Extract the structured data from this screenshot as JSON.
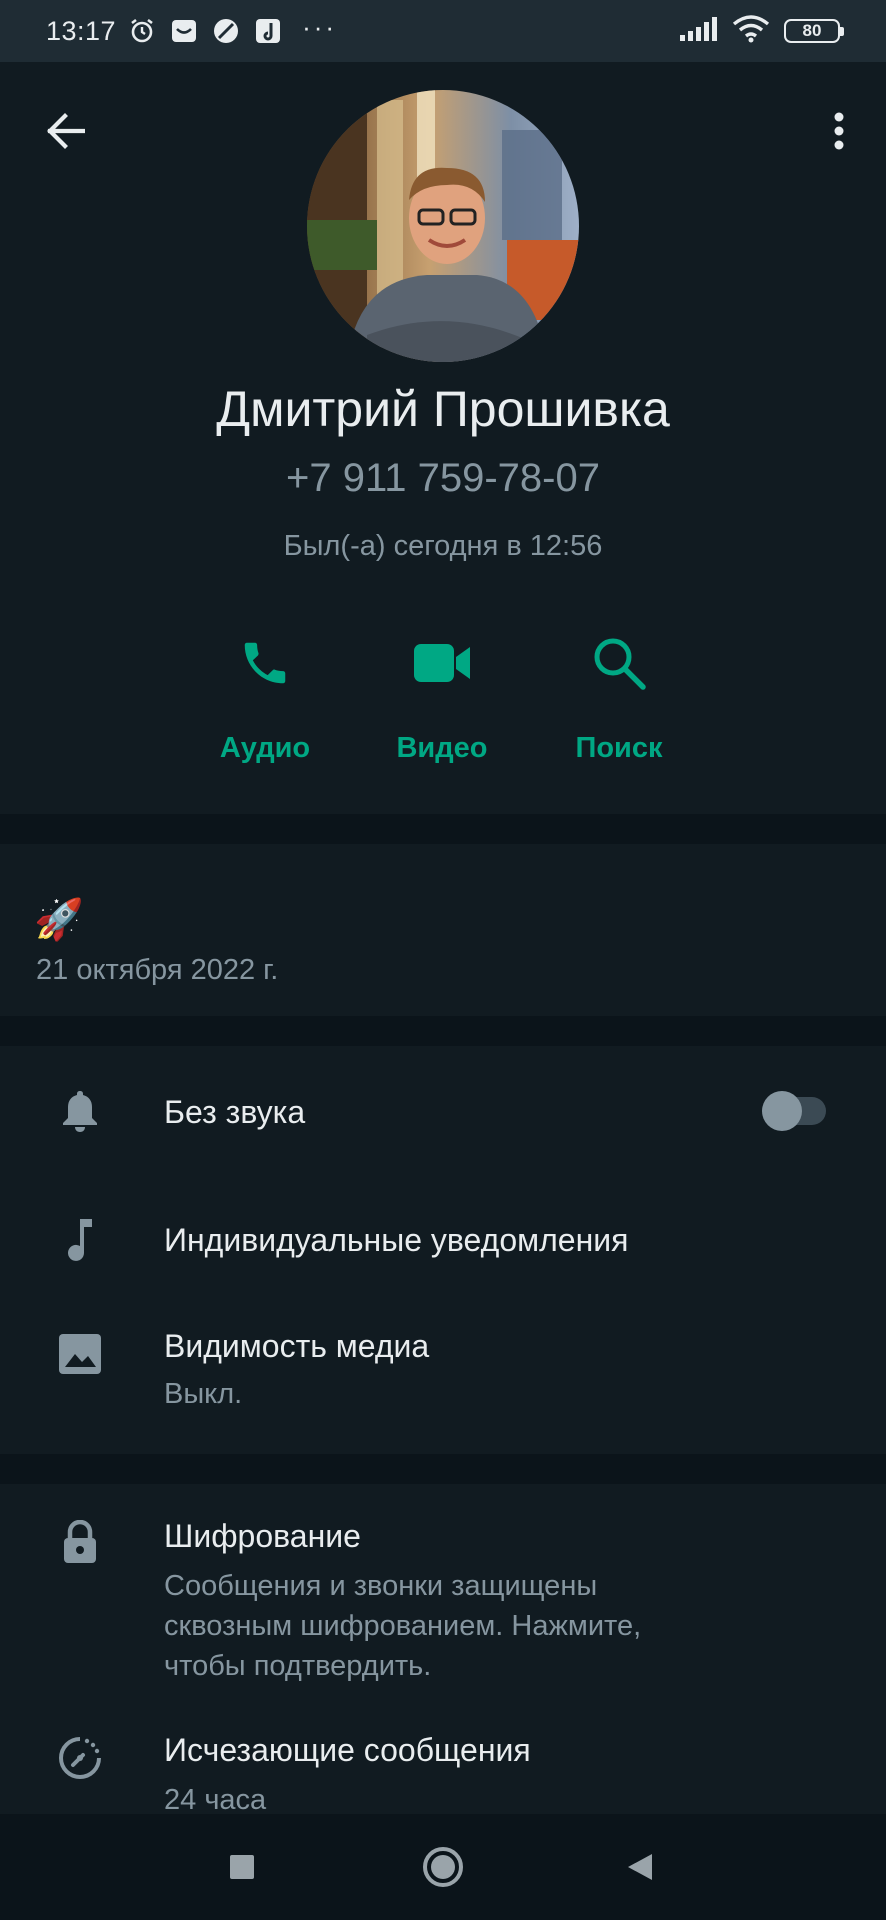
{
  "status_bar": {
    "time": "13:17",
    "overflow": "···",
    "battery": "80",
    "icons": [
      "alarm-icon",
      "mail-box-icon",
      "no-entry-icon",
      "music-app-icon",
      "signal-icon",
      "wifi-icon",
      "battery-icon"
    ]
  },
  "contact": {
    "name": "Дмитрий Прошивка",
    "phone": "+7 911 759-78-07",
    "last_seen": "Был(-а) сегодня в 12:56"
  },
  "actions": [
    {
      "label": "Аудио",
      "icon": "phone-icon"
    },
    {
      "label": "Видео",
      "icon": "video-camera-icon"
    },
    {
      "label": "Поиск",
      "icon": "search-icon"
    }
  ],
  "about": {
    "status": "🚀",
    "date": "21 октября 2022 г."
  },
  "settings": {
    "mute": {
      "title": "Без звука",
      "enabled": false,
      "icon": "bell-icon"
    },
    "custom_notifications": {
      "title": "Индивидуальные уведомления",
      "icon": "music-note-icon"
    },
    "media_visibility": {
      "title": "Видимость медиа",
      "subtitle": "Выкл.",
      "icon": "image-icon"
    }
  },
  "security": {
    "encryption": {
      "title": "Шифрование",
      "subtitle_line1": "Сообщения и звонки защищены",
      "subtitle_line2": "сквозным шифрованием. Нажмите,",
      "subtitle_line3": "чтобы подтвердить.",
      "icon": "lock-icon"
    },
    "disappearing": {
      "title": "Исчезающие сообщения",
      "subtitle": "24 часа",
      "icon": "timer-icon"
    }
  },
  "colors": {
    "accent": "#00a884",
    "background": "#0b141a",
    "panel": "#111b21",
    "text_primary": "#e9edef",
    "text_secondary": "#8696a0"
  }
}
